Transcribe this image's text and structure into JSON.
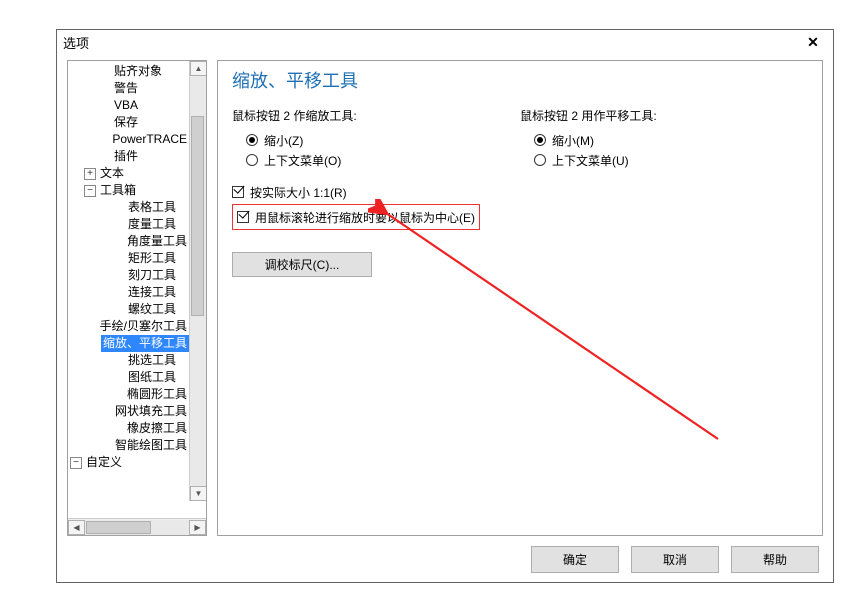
{
  "dialog": {
    "title": "选项"
  },
  "tree": {
    "items": [
      {
        "indent": 3,
        "label": "贴齐对象"
      },
      {
        "indent": 3,
        "label": "警告"
      },
      {
        "indent": 3,
        "label": "VBA"
      },
      {
        "indent": 3,
        "label": "保存"
      },
      {
        "indent": 3,
        "label": "PowerTRACE"
      },
      {
        "indent": 3,
        "label": "插件"
      },
      {
        "indent": 2,
        "expander": "+",
        "label": "文本"
      },
      {
        "indent": 2,
        "expander": "-",
        "label": "工具箱"
      },
      {
        "indent": 4,
        "label": "表格工具"
      },
      {
        "indent": 4,
        "label": "度量工具"
      },
      {
        "indent": 4,
        "label": "角度量工具"
      },
      {
        "indent": 4,
        "label": "矩形工具"
      },
      {
        "indent": 4,
        "label": "刻刀工具"
      },
      {
        "indent": 4,
        "label": "连接工具"
      },
      {
        "indent": 4,
        "label": "螺纹工具"
      },
      {
        "indent": 4,
        "label": "手绘/贝塞尔工具"
      },
      {
        "indent": 4,
        "label": "缩放、平移工具",
        "selected": true
      },
      {
        "indent": 4,
        "label": "挑选工具"
      },
      {
        "indent": 4,
        "label": "图纸工具"
      },
      {
        "indent": 4,
        "label": "椭圆形工具"
      },
      {
        "indent": 4,
        "label": "网状填充工具"
      },
      {
        "indent": 4,
        "label": "橡皮擦工具"
      },
      {
        "indent": 4,
        "label": "智能绘图工具"
      },
      {
        "indent": 1,
        "expander": "-",
        "label": "自定义"
      }
    ]
  },
  "panel": {
    "heading": "缩放、平移工具",
    "group1_label": "鼠标按钮 2 作缩放工具:",
    "group1_radio1": "缩小(Z)",
    "group1_radio2": "上下文菜单(O)",
    "group2_label": "鼠标按钮 2 用作平移工具:",
    "group2_radio1": "缩小(M)",
    "group2_radio2": "上下文菜单(U)",
    "check1": "按实际大小 1:1(R)",
    "check2": "用鼠标滚轮进行缩放时要以鼠标为中心(E)",
    "calibrate_btn": "调校标尺(C)..."
  },
  "footer": {
    "ok": "确定",
    "cancel": "取消",
    "help": "帮助"
  }
}
